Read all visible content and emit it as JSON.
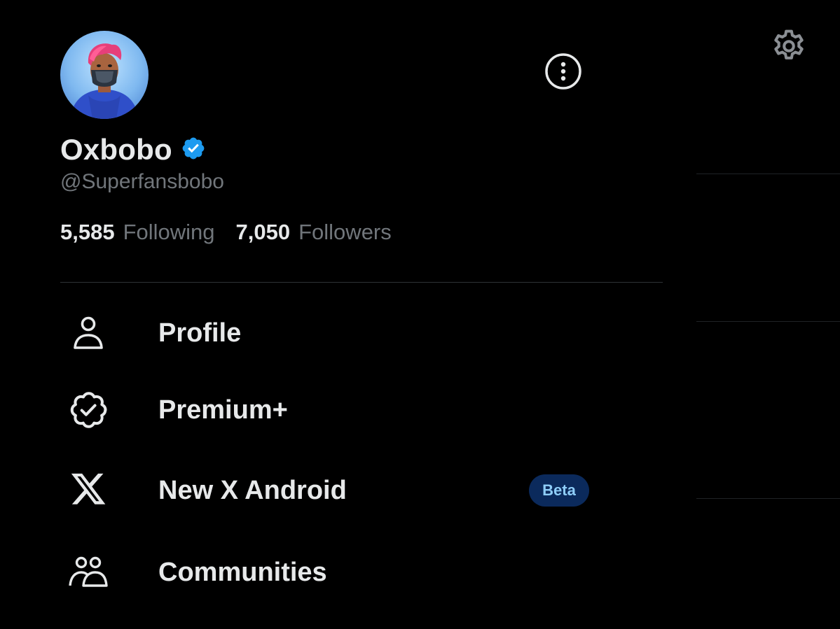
{
  "profile": {
    "display_name": "Oxbobo",
    "handle": "@Superfansbobo",
    "verified": true,
    "avatar_icon": "avatar-masked-man-pink-hair"
  },
  "stats": {
    "following_count": "5,585",
    "following_label": "Following",
    "followers_count": "7,050",
    "followers_label": "Followers"
  },
  "menu": {
    "items": [
      {
        "icon": "person-icon",
        "label": "Profile"
      },
      {
        "icon": "verified-badge-icon",
        "label": "Premium+"
      },
      {
        "icon": "x-logo-icon",
        "label": "New X Android",
        "badge": "Beta"
      },
      {
        "icon": "people-icon",
        "label": "Communities"
      }
    ]
  },
  "colors": {
    "background": "#000000",
    "text_primary": "#e7e9ea",
    "text_secondary": "#71767b",
    "verified_blue": "#1d9bf0",
    "beta_bg": "#0b2a5c",
    "beta_text": "#8ecdf8",
    "divider": "#2f3336"
  }
}
